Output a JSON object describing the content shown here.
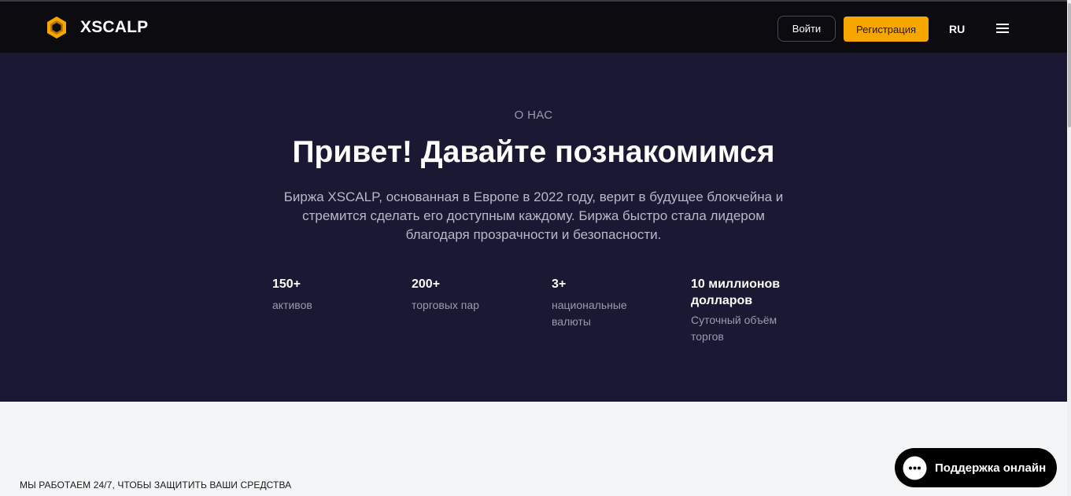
{
  "header": {
    "brand": "XSCALP",
    "login_label": "Войти",
    "register_label": "Регистрация",
    "language": "RU"
  },
  "hero": {
    "section_label": "О НАС",
    "title": "Привет! Давайте познакомимся",
    "description": "Биржа XSCALP, основанная в Европе в 2022 году, верит в будущее блокчейна и стремится сделать его доступным каждому. Биржа быстро стала лидером благодаря прозрачности и безопасности.",
    "stats": [
      {
        "value": "150+",
        "label": "активов"
      },
      {
        "value": "200+",
        "label": "торговых пар"
      },
      {
        "value": "3+",
        "label": "национальные валюты"
      },
      {
        "value": "10 миллионов долларов",
        "label": "Суточный объём торгов"
      }
    ]
  },
  "lower_section": {
    "heading": "МЫ РАБОТАЕМ 24/7, ЧТОБЫ ЗАЩИТИТЬ ВАШИ СРЕДСТВА"
  },
  "support_widget": {
    "label": "Поддержка онлайн"
  },
  "colors": {
    "header_bg": "#0b0b10",
    "hero_bg": "#1a1833",
    "accent": "#f7a600",
    "page_bg": "#f4f5f7"
  },
  "icons": {
    "logo": "hexagon-logo-icon",
    "menu": "hamburger-menu-icon",
    "support": "chat-bubble-icon"
  }
}
